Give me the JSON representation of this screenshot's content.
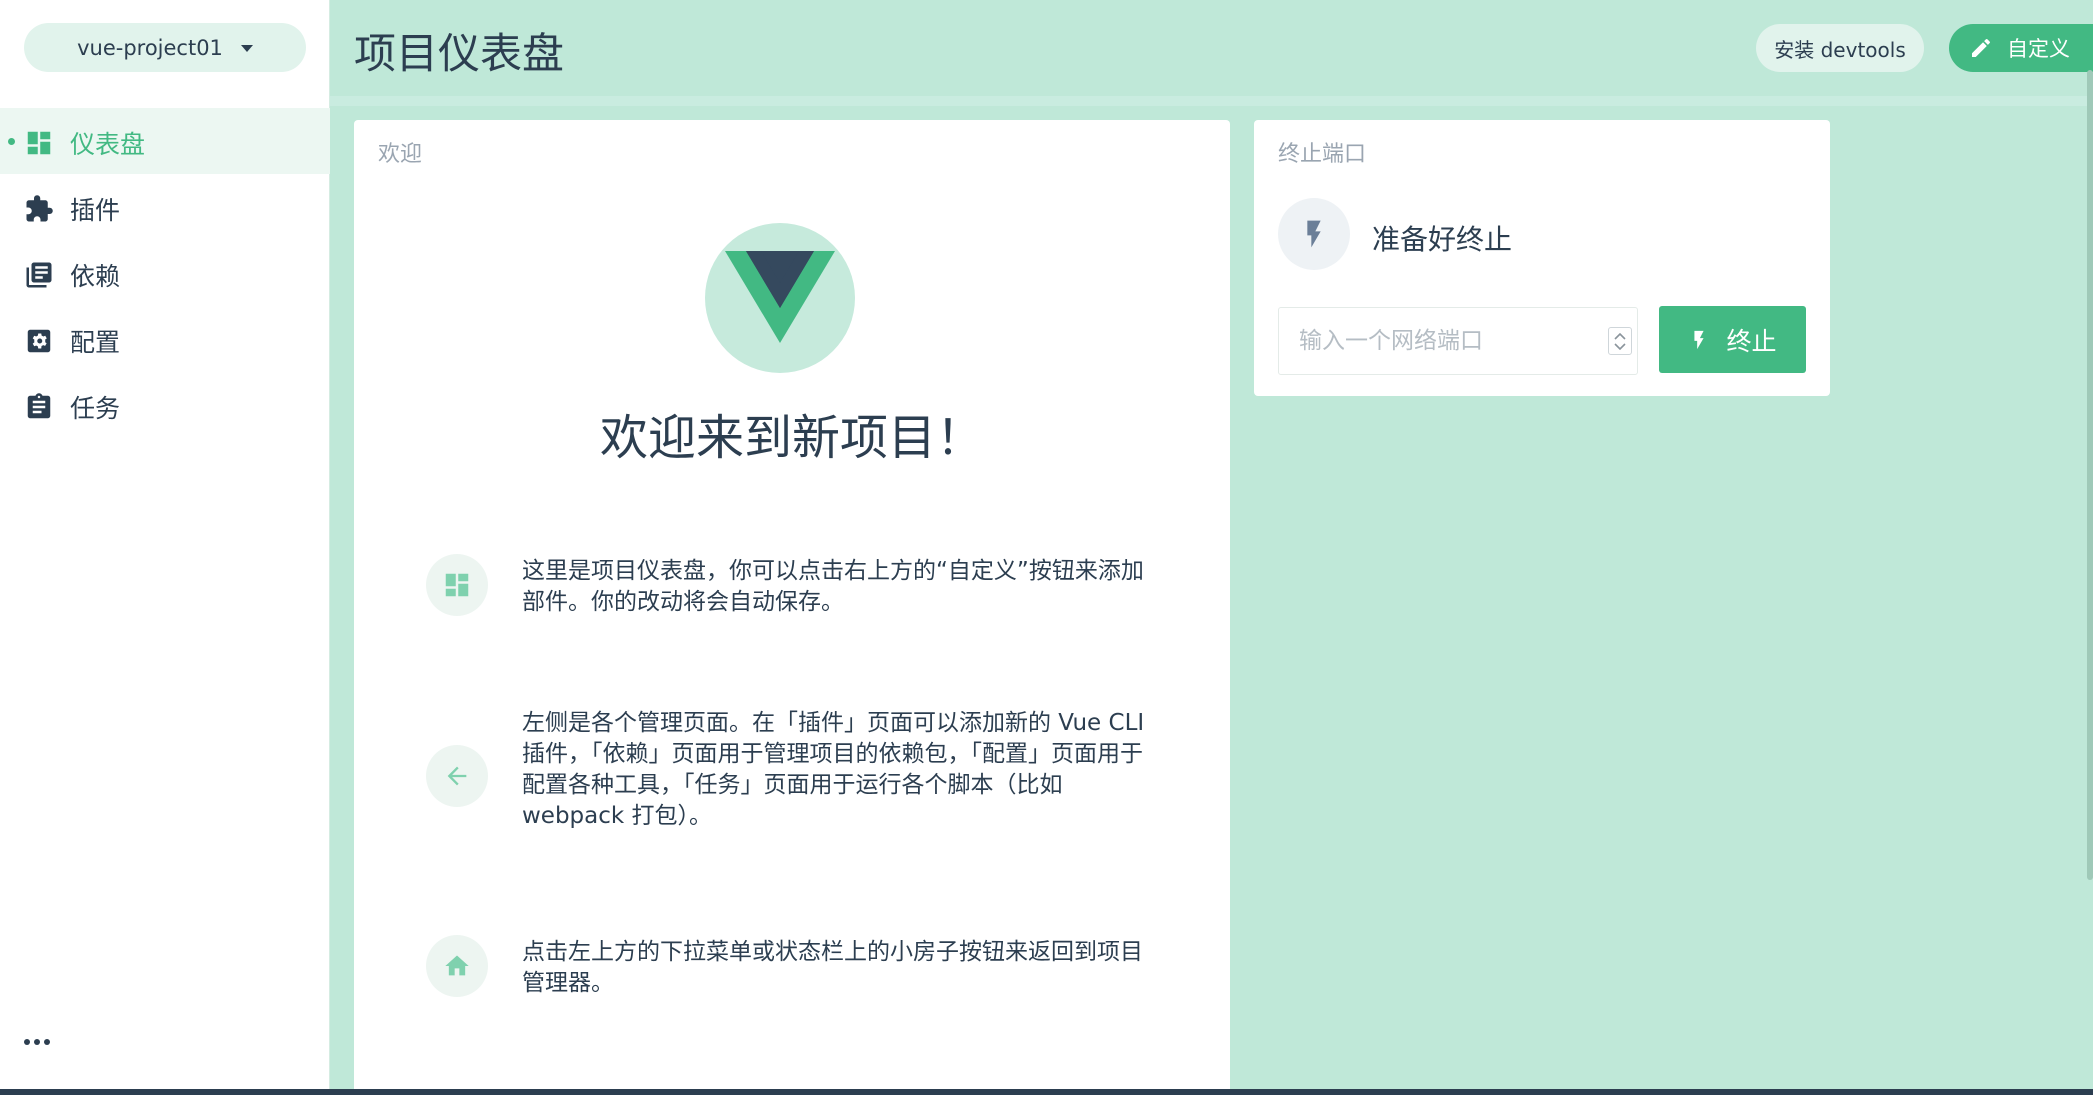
{
  "project": {
    "name": "vue-project01"
  },
  "sidebar": {
    "items": [
      {
        "label": "仪表盘",
        "icon": "dashboard-icon",
        "active": true
      },
      {
        "label": "插件",
        "icon": "puzzle-icon",
        "active": false
      },
      {
        "label": "依赖",
        "icon": "library-books-icon",
        "active": false
      },
      {
        "label": "配置",
        "icon": "settings-box-icon",
        "active": false
      },
      {
        "label": "任务",
        "icon": "clipboard-icon",
        "active": false
      }
    ],
    "more_icon": "more-horiz-icon"
  },
  "header": {
    "title": "项目仪表盘",
    "devtools_label": "安装 devtools",
    "customize_label": "自定义"
  },
  "welcome": {
    "card_title": "欢迎",
    "heading": "欢迎来到新项目！",
    "tips": [
      {
        "icon": "dashboard-icon",
        "text": "这里是项目仪表盘，你可以点击右上方的“自定义”按钮来添加部件。你的改动将会自动保存。"
      },
      {
        "icon": "arrow-left-icon",
        "text": "左侧是各个管理页面。在「插件」页面可以添加新的 Vue CLI 插件，「依赖」页面用于管理项目的依赖包，「配置」页面用于配置各种工具，「任务」页面用于运行各个脚本（比如 webpack 打包）。"
      },
      {
        "icon": "home-icon",
        "text": "点击左上方的下拉菜单或状态栏上的小房子按钮来返回到项目管理器。"
      }
    ]
  },
  "kill_port": {
    "card_title": "终止端口",
    "status": "准备好终止",
    "input_placeholder": "输入一个网络端口",
    "input_value": "",
    "button_label": "终止"
  },
  "colors": {
    "accent": "#42b983",
    "background": "#bfe8d8",
    "text": "#2c3e50",
    "muted": "#9aa5b1"
  }
}
